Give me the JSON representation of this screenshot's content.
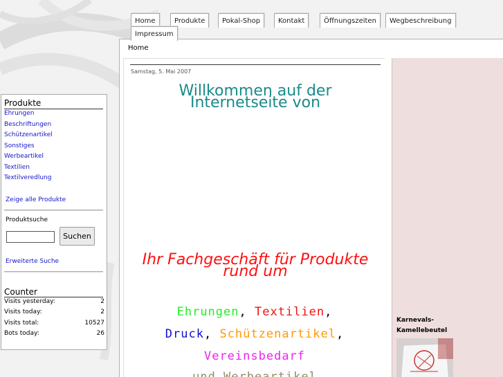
{
  "nav": {
    "tabs": [
      {
        "label": "Home"
      },
      {
        "label": "Produkte"
      },
      {
        "label": "Pokal-Shop"
      },
      {
        "label": "Kontakt"
      },
      {
        "label": "Öffnungszeiten"
      },
      {
        "label": "Wegbeschreibung"
      },
      {
        "label": "Impressum"
      }
    ]
  },
  "breadcrumb": "Home",
  "content": {
    "date": "Samstag, 5. Mai 2007",
    "welcome_line1": "Willkommen auf der",
    "welcome_line2": "Internetseite von",
    "tagline_line1": "Ihr Fachgeschäft für Produkte",
    "tagline_line2": "rund um",
    "items": [
      {
        "text": "Ehrungen",
        "color": "#22ee22"
      },
      {
        "text": "Textilien",
        "color": "#ee1111"
      },
      {
        "text": "Druck",
        "color": "#1111cc"
      },
      {
        "text": "Schützenartikel",
        "color": "#ff9900"
      },
      {
        "text": "Vereinsbedarf",
        "color": "#ee22ee"
      },
      {
        "text": "und Werbeartikel",
        "color": "#998866"
      }
    ],
    "sep_comma": ","
  },
  "sidebar": {
    "products_heading": "Produkte",
    "product_links": [
      "Ehrungen",
      "Beschriftungen",
      "Schützenartikel",
      "Sonstiges",
      "Werbeartikel",
      "Textilien",
      "Textilveredlung"
    ],
    "show_all": "Zeige alle Produkte",
    "search_label": "Produktsuche",
    "search_button": "Suchen",
    "advanced_search": "Erweiterte Suche",
    "counter_heading": "Counter",
    "counter": [
      {
        "label": "Visits yesterday:",
        "value": "2"
      },
      {
        "label": "Visits today:",
        "value": "2"
      },
      {
        "label": "Visits total:",
        "value": "10527"
      },
      {
        "label": "Bots today:",
        "value": "26"
      }
    ]
  },
  "promo": {
    "title_line1": "Karnevals-",
    "title_line2": "Kamellebeutel"
  },
  "colors": {
    "welcome": "#1a8a8a",
    "tagline": "#ff1010",
    "link": "#1515cc",
    "right_col_bg": "#efdede"
  }
}
